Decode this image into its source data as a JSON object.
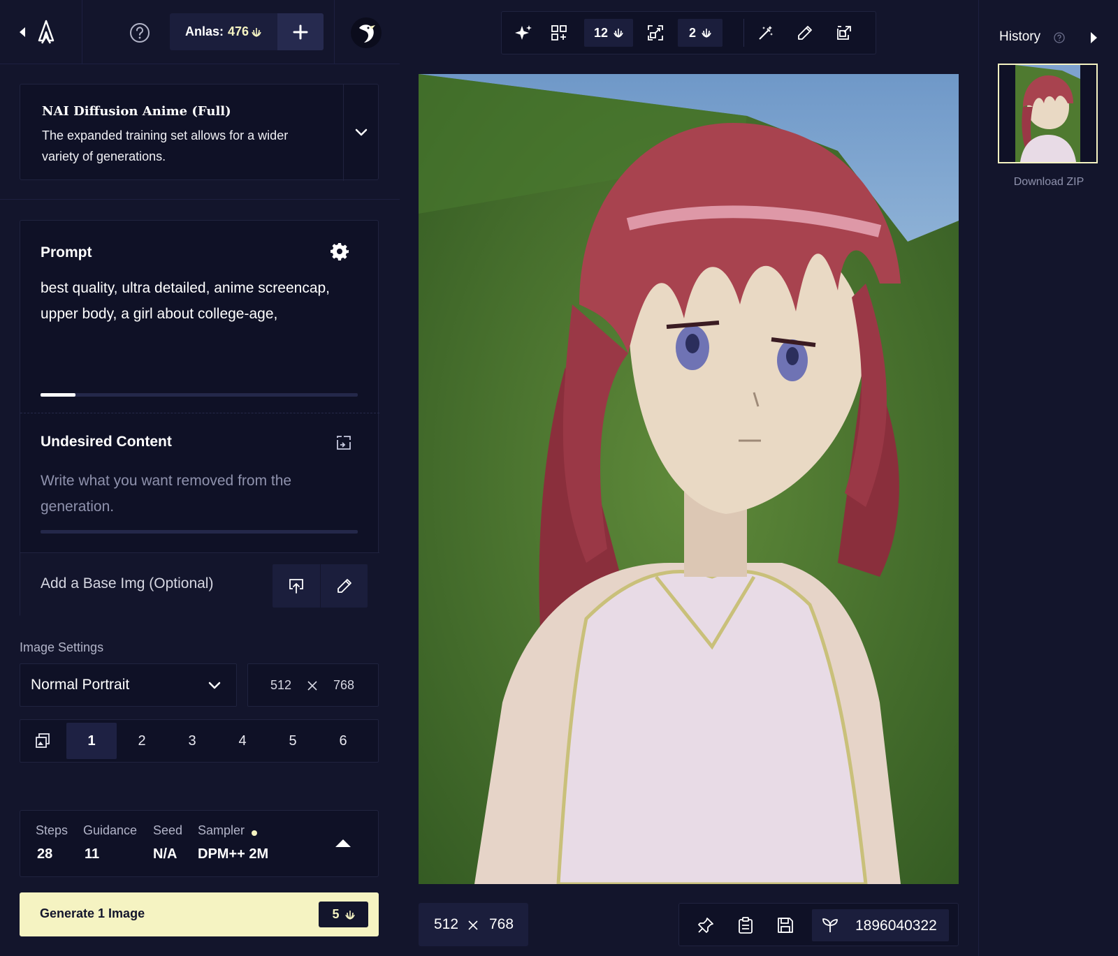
{
  "header": {
    "anlas_label": "Anlas:",
    "anlas_value": "476"
  },
  "model": {
    "name": "NAI Diffusion Anime (Full)",
    "description": "The expanded training set allows for a wider variety of generations."
  },
  "prompt": {
    "title": "Prompt",
    "text": "best quality,  ultra detailed,  anime screencap,  upper body,  a girl about college-age,",
    "token_progress": 0.11
  },
  "undesired": {
    "title": "Undesired Content",
    "placeholder": "Write what you want removed from the generation."
  },
  "base_image": {
    "label": "Add a Base Img (Optional)"
  },
  "image_settings": {
    "label": "Image Settings",
    "preset": "Normal Portrait",
    "width": "512",
    "height": "768",
    "count_options": [
      "1",
      "2",
      "3",
      "4",
      "5",
      "6"
    ],
    "selected_count": "1"
  },
  "params": {
    "steps_label": "Steps",
    "steps_value": "28",
    "guidance_label": "Guidance",
    "guidance_value": "11",
    "seed_label": "Seed",
    "seed_value": "N/A",
    "sampler_label": "Sampler",
    "sampler_value": "DPM++ 2M"
  },
  "generate": {
    "label": "Generate 1 Image",
    "cost": "5"
  },
  "toolbar": {
    "variations_cost": "12",
    "upscale_cost": "2"
  },
  "canvas": {
    "width": "512",
    "height": "768",
    "seed": "1896040322"
  },
  "history": {
    "title": "History",
    "download_label": "Download ZIP"
  },
  "colors": {
    "background": "#13152c",
    "panel": "#0f1126",
    "accent": "#f5f3c2"
  },
  "icons": [
    "chevron-left-icon",
    "novelai-logo-icon",
    "help-icon",
    "anlas-icon",
    "plus-icon",
    "avatar-icon",
    "chevron-down-icon",
    "gear-icon",
    "import-icon",
    "upload-icon",
    "pencil-icon",
    "images-icon",
    "chevron-up-icon",
    "sparkle-icon",
    "variations-icon",
    "upscale-icon",
    "magic-wand-icon",
    "inpaint-icon",
    "export-icon",
    "pin-icon",
    "clipboard-icon",
    "save-icon",
    "seed-icon",
    "history-help-icon",
    "chevron-right-icon"
  ]
}
